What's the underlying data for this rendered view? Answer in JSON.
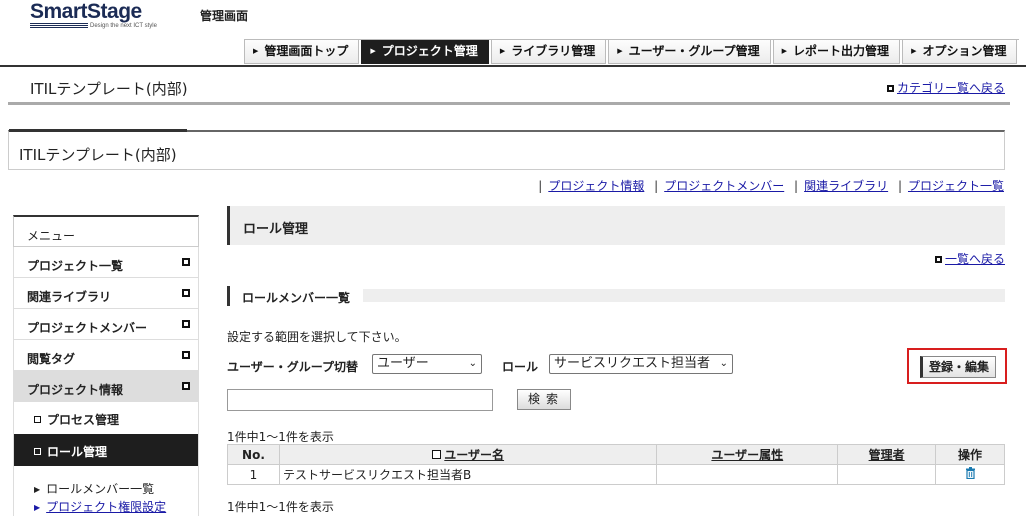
{
  "header": {
    "logo_text": "SmartStage",
    "logo_tagline": "Design the next ICT style",
    "admin_label": "管理画面",
    "nav_tabs": [
      {
        "label": "管理画面トップ",
        "active": false
      },
      {
        "label": "プロジェクト管理",
        "active": true
      },
      {
        "label": "ライブラリ管理",
        "active": false
      },
      {
        "label": "ユーザー・グループ管理",
        "active": false
      },
      {
        "label": "レポート出力管理",
        "active": false
      },
      {
        "label": "オプション管理",
        "active": false
      }
    ]
  },
  "category": {
    "title": "ITILテンプレート(内部)",
    "back_link": "カテゴリー覧へ戻る"
  },
  "project": {
    "title": "ITILテンプレート(内部)",
    "links": [
      "プロジェクト情報",
      "プロジェクトメンバー",
      "関連ライブラリ",
      "プロジェクト一覧"
    ]
  },
  "sidebar": {
    "menu_label": "メニュー",
    "items": [
      {
        "label": "プロジェクト一覧"
      },
      {
        "label": "関連ライブラリ"
      },
      {
        "label": "プロジェクトメンバー"
      },
      {
        "label": "閲覧タグ"
      },
      {
        "label": "プロジェクト情報"
      }
    ],
    "sub_items": [
      {
        "label": "プロセス管理"
      },
      {
        "label": "ロール管理"
      }
    ],
    "leaf_items": [
      "ロールメンバー一覧",
      "プロジェクト権限設定"
    ]
  },
  "main": {
    "title": "ロール管理",
    "back_link": "一覧へ戻る",
    "section_title": "ロールメンバー一覧",
    "instruction": "設定する範囲を選択して下さい。",
    "filter": {
      "group_label": "ユーザー・グループ切替",
      "group_value": "ユーザー",
      "role_label": "ロール",
      "role_value": "サービスリクエスト担当者"
    },
    "register_button": "登録・編集",
    "search_value": "",
    "search_button": "検索",
    "count_text": "1件中1～1件を表示",
    "table": {
      "columns": [
        "No.",
        "ユーザー名",
        "ユーザー属性",
        "管理者",
        "操作"
      ],
      "rows": [
        {
          "no": "1",
          "user": "テストサービスリクエスト担当者B",
          "attr": "",
          "admin": "",
          "action_icon": "trash-icon"
        }
      ]
    }
  }
}
